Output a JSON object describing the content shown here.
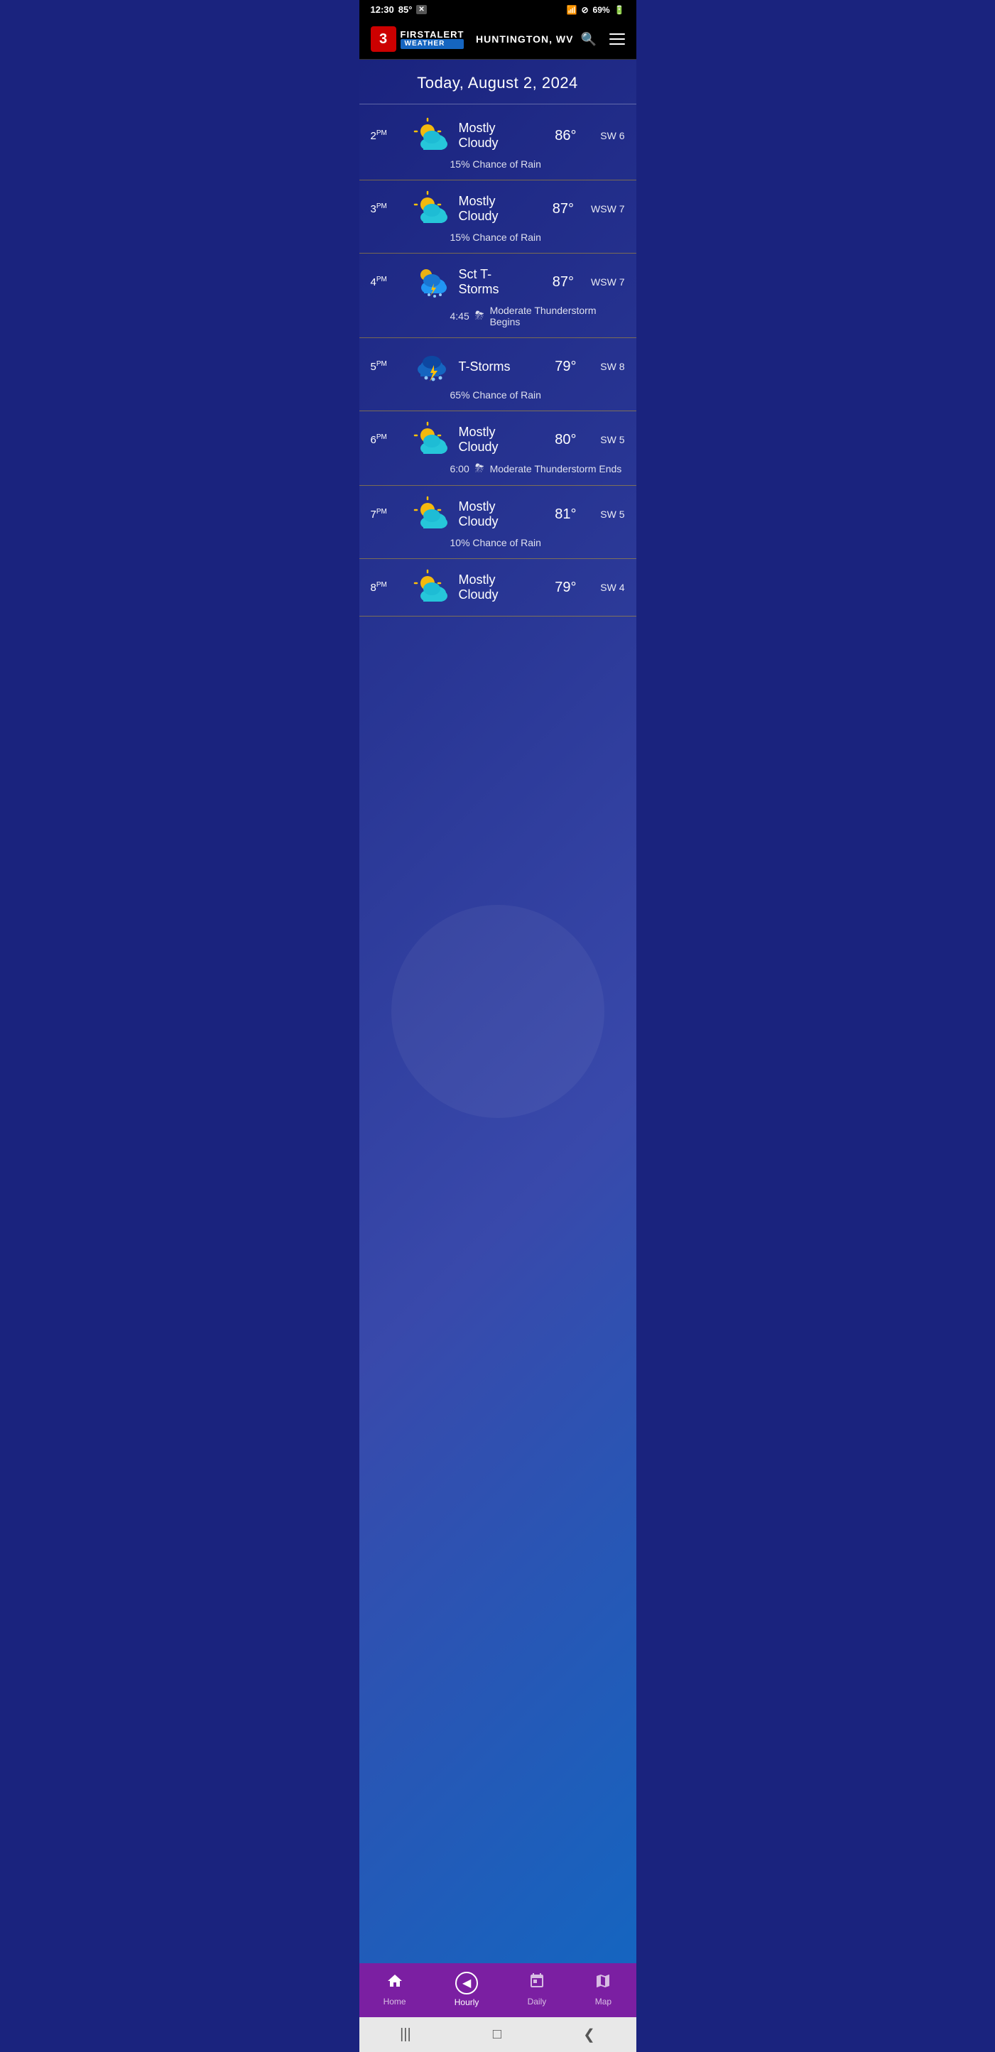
{
  "statusBar": {
    "time": "12:30",
    "temp": "85°",
    "battery": "69%"
  },
  "header": {
    "channelNumber": "3",
    "firstAlert": "FIRSTALERT",
    "weather": "WEATHER",
    "location": "HUNTINGTON, WV",
    "menuLabel": "menu"
  },
  "dateHeader": "Today, August 2, 2024",
  "weatherRows": [
    {
      "time": "2",
      "period": "PM",
      "iconType": "mostly-cloudy-day",
      "condition": "Mostly Cloudy",
      "temp": "86°",
      "wind": "SW 6",
      "detail": "15% Chance of Rain",
      "detailIcon": "",
      "detailTime": ""
    },
    {
      "time": "3",
      "period": "PM",
      "iconType": "mostly-cloudy-day",
      "condition": "Mostly Cloudy",
      "temp": "87°",
      "wind": "WSW 7",
      "detail": "15% Chance of Rain",
      "detailIcon": "",
      "detailTime": ""
    },
    {
      "time": "4",
      "period": "PM",
      "iconType": "thunderstorm-day",
      "condition": "Sct T-Storms",
      "temp": "87°",
      "wind": "WSW 7",
      "detail": "Moderate Thunderstorm Begins",
      "detailIcon": "⛈",
      "detailTime": "4:45"
    },
    {
      "time": "5",
      "period": "PM",
      "iconType": "thunderstorm",
      "condition": "T-Storms",
      "temp": "79°",
      "wind": "SW 8",
      "detail": "65% Chance of Rain",
      "detailIcon": "",
      "detailTime": ""
    },
    {
      "time": "6",
      "period": "PM",
      "iconType": "mostly-cloudy-day",
      "condition": "Mostly Cloudy",
      "temp": "80°",
      "wind": "SW 5",
      "detail": "Moderate Thunderstorm Ends",
      "detailIcon": "⛈",
      "detailTime": "6:00"
    },
    {
      "time": "7",
      "period": "PM",
      "iconType": "mostly-cloudy-day",
      "condition": "Mostly Cloudy",
      "temp": "81°",
      "wind": "SW 5",
      "detail": "10% Chance of Rain",
      "detailIcon": "",
      "detailTime": ""
    },
    {
      "time": "8",
      "period": "PM",
      "iconType": "mostly-cloudy-day",
      "condition": "Mostly Cloudy",
      "temp": "79°",
      "wind": "SW 4",
      "detail": "",
      "detailIcon": "",
      "detailTime": ""
    }
  ],
  "bottomNav": {
    "items": [
      {
        "id": "home",
        "label": "Home",
        "icon": "🏠",
        "active": false
      },
      {
        "id": "hourly",
        "label": "Hourly",
        "icon": "◀",
        "active": true
      },
      {
        "id": "daily",
        "label": "Daily",
        "icon": "📅",
        "active": false
      },
      {
        "id": "map",
        "label": "Map",
        "icon": "🗺",
        "active": false
      }
    ]
  },
  "systemNav": {
    "back": "❮",
    "home": "□",
    "recent": "|||"
  }
}
